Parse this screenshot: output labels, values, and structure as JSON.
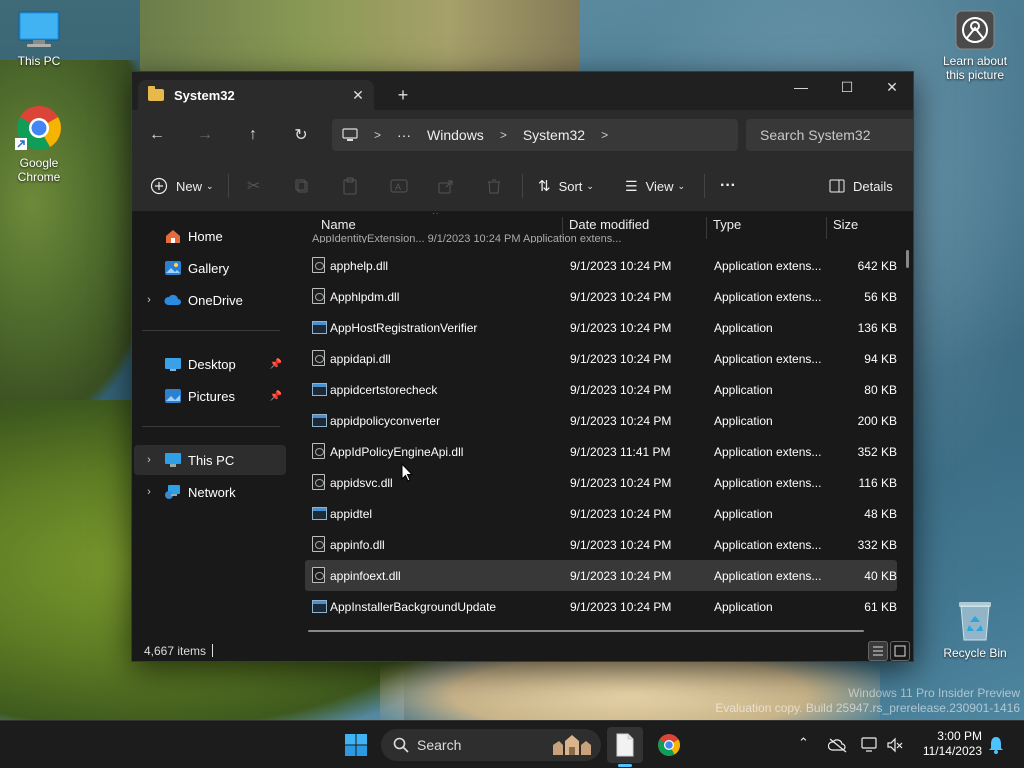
{
  "desktop": {
    "icons": {
      "this_pc": "This PC",
      "chrome_line1": "Google",
      "chrome_line2": "Chrome",
      "recycle_bin": "Recycle Bin",
      "learn_line1": "Learn about",
      "learn_line2": "this picture"
    },
    "watermark": {
      "line1": "Windows 11 Pro Insider Preview",
      "line2": "Evaluation copy. Build 25947.rs_prerelease.230901-1416"
    }
  },
  "window": {
    "tab_title": "System32",
    "tab_close": "✕",
    "new_tab": "+",
    "controls": {
      "minimize": "—",
      "maximize": "☐",
      "close": "✕"
    },
    "nav": {
      "back": "←",
      "forward": "→",
      "up": "↑",
      "refresh": "↻"
    },
    "breadcrumb": {
      "ellipsis": "···",
      "items": [
        "Windows",
        "System32"
      ],
      "sep": ">"
    },
    "search_placeholder": "Search System32",
    "toolbar": {
      "new_label": "New",
      "sort_label": "Sort",
      "view_label": "View",
      "more_label": "···",
      "details_label": "Details"
    },
    "sidebar": {
      "home": "Home",
      "gallery": "Gallery",
      "onedrive": "OneDrive",
      "desktop": "Desktop",
      "pictures": "Pictures",
      "this_pc": "This PC",
      "network": "Network"
    },
    "columns": {
      "name": "Name",
      "date": "Date modified",
      "type": "Type",
      "size": "Size"
    },
    "partial_row": "AppIdentityExtension... 9/1/2023 10:24 PM Application extens...",
    "files": [
      {
        "name": "apphelp.dll",
        "date": "9/1/2023 10:24 PM",
        "type": "Application extens...",
        "size": "642 KB",
        "kind": "dll"
      },
      {
        "name": "Apphlpdm.dll",
        "date": "9/1/2023 10:24 PM",
        "type": "Application extens...",
        "size": "56 KB",
        "kind": "dll"
      },
      {
        "name": "AppHostRegistrationVerifier",
        "date": "9/1/2023 10:24 PM",
        "type": "Application",
        "size": "136 KB",
        "kind": "exe"
      },
      {
        "name": "appidapi.dll",
        "date": "9/1/2023 10:24 PM",
        "type": "Application extens...",
        "size": "94 KB",
        "kind": "dll"
      },
      {
        "name": "appidcertstorecheck",
        "date": "9/1/2023 10:24 PM",
        "type": "Application",
        "size": "80 KB",
        "kind": "exe"
      },
      {
        "name": "appidpolicyconverter",
        "date": "9/1/2023 10:24 PM",
        "type": "Application",
        "size": "200 KB",
        "kind": "exe"
      },
      {
        "name": "AppIdPolicyEngineApi.dll",
        "date": "9/1/2023 11:41 PM",
        "type": "Application extens...",
        "size": "352 KB",
        "kind": "dll"
      },
      {
        "name": "appidsvc.dll",
        "date": "9/1/2023 10:24 PM",
        "type": "Application extens...",
        "size": "116 KB",
        "kind": "dll"
      },
      {
        "name": "appidtel",
        "date": "9/1/2023 10:24 PM",
        "type": "Application",
        "size": "48 KB",
        "kind": "exe"
      },
      {
        "name": "appinfo.dll",
        "date": "9/1/2023 10:24 PM",
        "type": "Application extens...",
        "size": "332 KB",
        "kind": "dll"
      },
      {
        "name": "appinfoext.dll",
        "date": "9/1/2023 10:24 PM",
        "type": "Application extens...",
        "size": "40 KB",
        "kind": "dll",
        "selected": true
      },
      {
        "name": "AppInstallerBackgroundUpdate",
        "date": "9/1/2023 10:24 PM",
        "type": "Application",
        "size": "61 KB",
        "kind": "exe"
      }
    ],
    "status": {
      "item_count": "4,667 items"
    }
  },
  "taskbar": {
    "search_label": "Search",
    "clock_time": "3:00 PM",
    "clock_date": "11/14/2023"
  },
  "colors": {
    "accent": "#4cc2ff",
    "window_bg": "#191919",
    "toolbar_bg": "#2b2b2b",
    "folder": "#e8b84a"
  }
}
